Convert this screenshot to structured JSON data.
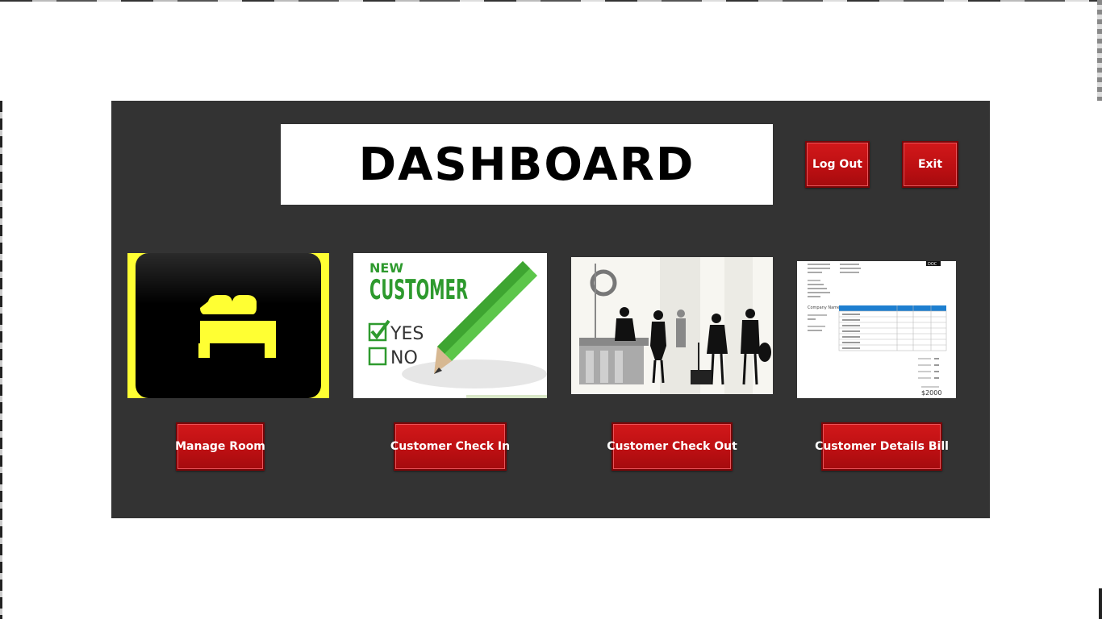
{
  "header": {
    "title": "DASHBOARD",
    "logout_label": "Log Out",
    "exit_label": "Exit"
  },
  "tiles": {
    "room": {
      "icon": "bed-icon",
      "button_label": "Manage Room"
    },
    "checkin": {
      "icon": "new-customer-pencil-icon",
      "button_label": "Customer Check In",
      "image_text_new": "NEW",
      "image_text_customer": "CUSTOMER",
      "image_text_yes": "YES",
      "image_text_no": "NO"
    },
    "checkout": {
      "icon": "hotel-reception-icon",
      "button_label": "Customer Check Out"
    },
    "bill": {
      "icon": "invoice-document-icon",
      "button_label": "Customer Details Bill",
      "image_text_company": "Company Name",
      "image_text_total": "$2000",
      "image_text_doc": "DOC"
    }
  },
  "colors": {
    "panel": "#333333",
    "button_red": "#c8141a",
    "bed_yellow": "#ffff33",
    "customer_green": "#2e9a2e"
  }
}
